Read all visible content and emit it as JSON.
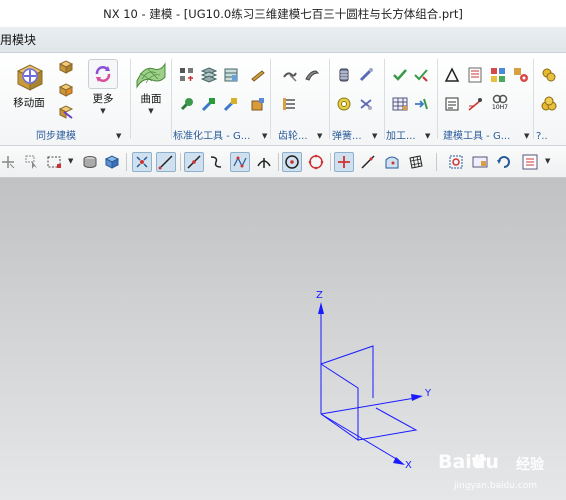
{
  "window": {
    "title": "NX 10 - 建模 - [UG10.0练习三维建模七百三十圆柱与长方体组合.prt]"
  },
  "menubar": {
    "module_label": "用模块"
  },
  "ribbon": {
    "groups": [
      {
        "label": "同步建模"
      },
      {
        "label": "标准化工具 - G..."
      },
      {
        "label": "齿轮..."
      },
      {
        "label": "弹簧..."
      },
      {
        "label": "加工..."
      },
      {
        "label": "建模工具 - G..."
      },
      {
        "label": "?.."
      }
    ],
    "buttons": {
      "move_face": "移动面",
      "more": "更多",
      "surface": "曲面"
    },
    "small_text": {
      "hole_label": "10H7"
    }
  },
  "viewport": {
    "axes": {
      "x": "X",
      "y": "Y",
      "z": "Z"
    },
    "colors": {
      "axis": "#1a1aff",
      "bg_top": "#bfc1c3",
      "bg_bottom": "#e6e7e8"
    }
  },
  "watermark": {
    "brand": "Baidu",
    "brand_cn": "经验",
    "url": "jingyan.baidu.com"
  }
}
